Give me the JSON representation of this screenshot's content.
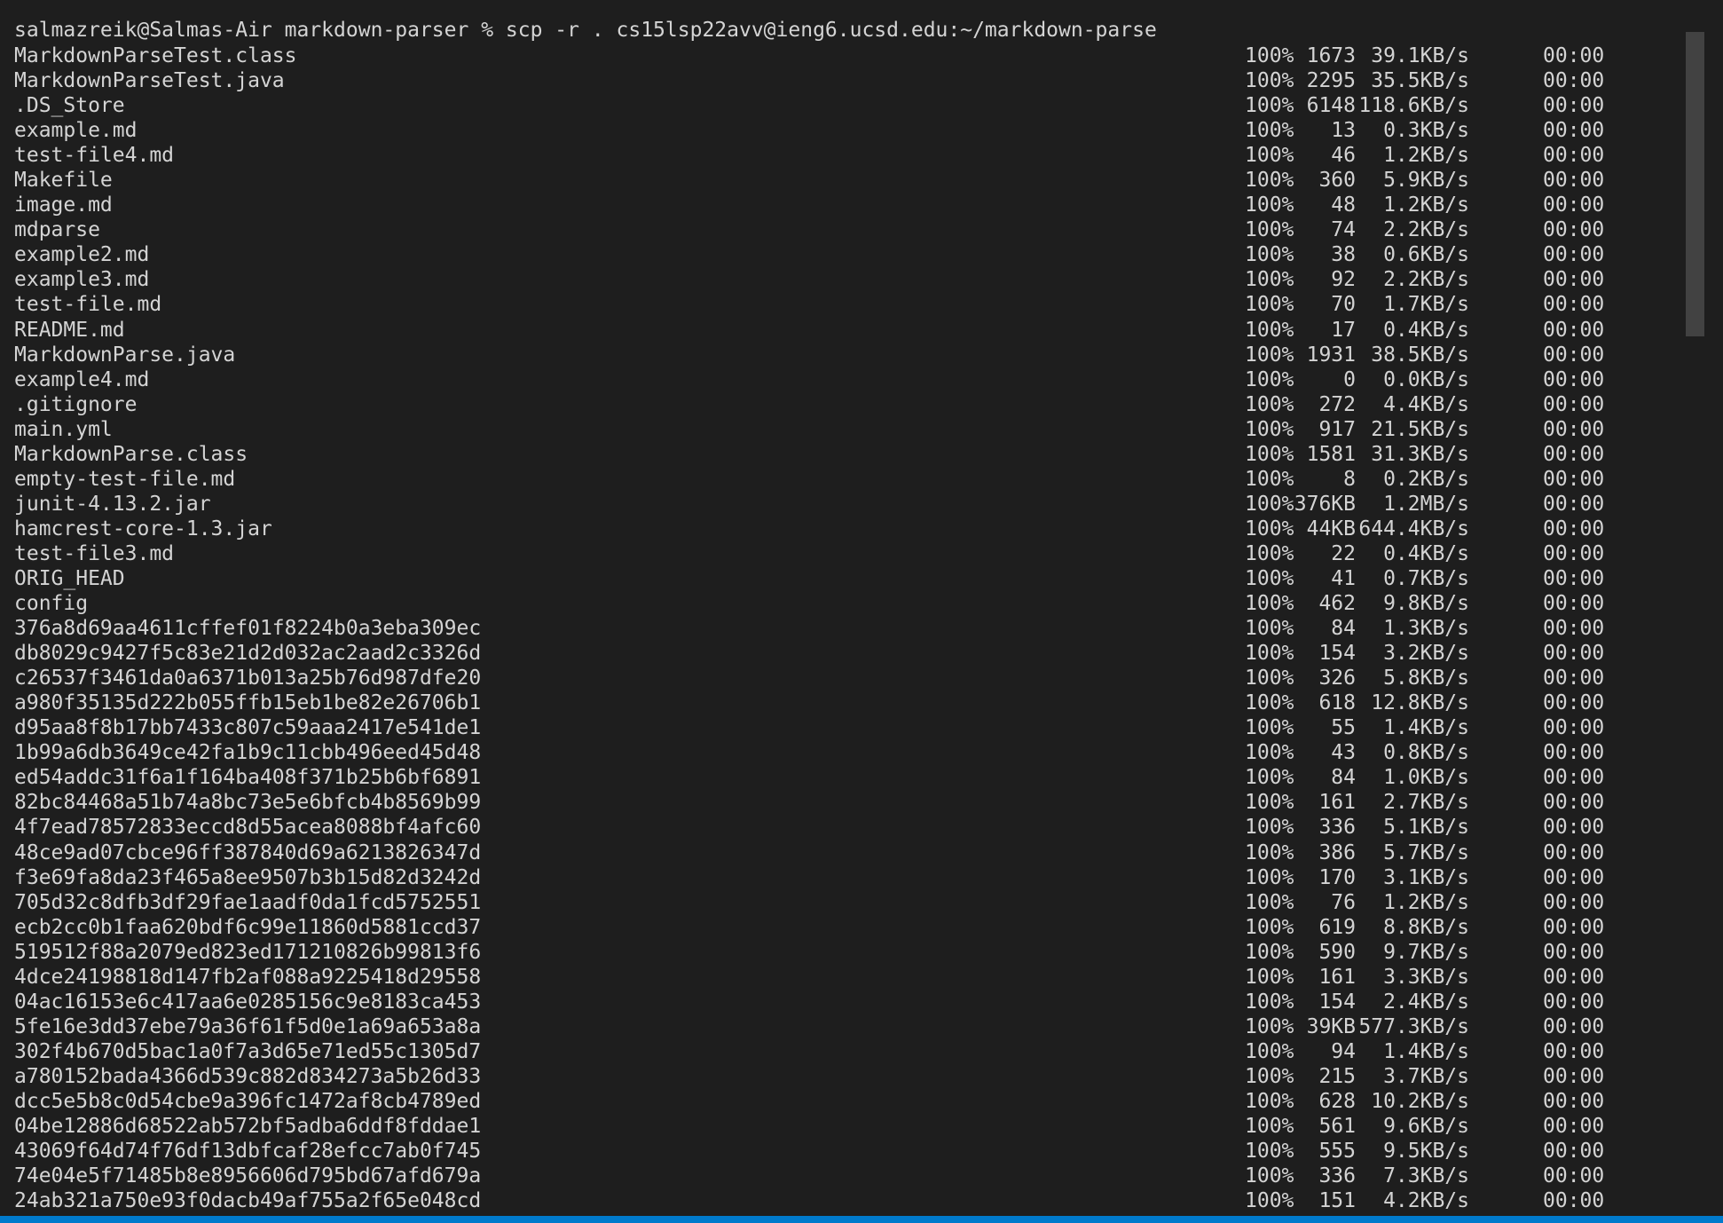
{
  "terminal": {
    "prompt": "salmazreik@Salmas-Air markdown-parser % ",
    "command": "scp -r . cs15lsp22avv@ieng6.ucsd.edu:~/markdown-parse",
    "rows": [
      {
        "file": "MarkdownParseTest.class",
        "pct": "100%",
        "size": "1673",
        "speed": "39.1KB/s",
        "eta": "00:00"
      },
      {
        "file": "MarkdownParseTest.java",
        "pct": "100%",
        "size": "2295",
        "speed": "35.5KB/s",
        "eta": "00:00"
      },
      {
        "file": ".DS_Store",
        "pct": "100%",
        "size": "6148",
        "speed": "118.6KB/s",
        "eta": "00:00"
      },
      {
        "file": "example.md",
        "pct": "100%",
        "size": "13",
        "speed": "0.3KB/s",
        "eta": "00:00"
      },
      {
        "file": "test-file4.md",
        "pct": "100%",
        "size": "46",
        "speed": "1.2KB/s",
        "eta": "00:00"
      },
      {
        "file": "Makefile",
        "pct": "100%",
        "size": "360",
        "speed": "5.9KB/s",
        "eta": "00:00"
      },
      {
        "file": "image.md",
        "pct": "100%",
        "size": "48",
        "speed": "1.2KB/s",
        "eta": "00:00"
      },
      {
        "file": "mdparse",
        "pct": "100%",
        "size": "74",
        "speed": "2.2KB/s",
        "eta": "00:00"
      },
      {
        "file": "example2.md",
        "pct": "100%",
        "size": "38",
        "speed": "0.6KB/s",
        "eta": "00:00"
      },
      {
        "file": "example3.md",
        "pct": "100%",
        "size": "92",
        "speed": "2.2KB/s",
        "eta": "00:00"
      },
      {
        "file": "test-file.md",
        "pct": "100%",
        "size": "70",
        "speed": "1.7KB/s",
        "eta": "00:00"
      },
      {
        "file": "README.md",
        "pct": "100%",
        "size": "17",
        "speed": "0.4KB/s",
        "eta": "00:00"
      },
      {
        "file": "MarkdownParse.java",
        "pct": "100%",
        "size": "1931",
        "speed": "38.5KB/s",
        "eta": "00:00"
      },
      {
        "file": "example4.md",
        "pct": "100%",
        "size": "0",
        "speed": "0.0KB/s",
        "eta": "00:00"
      },
      {
        "file": ".gitignore",
        "pct": "100%",
        "size": "272",
        "speed": "4.4KB/s",
        "eta": "00:00"
      },
      {
        "file": "main.yml",
        "pct": "100%",
        "size": "917",
        "speed": "21.5KB/s",
        "eta": "00:00"
      },
      {
        "file": "MarkdownParse.class",
        "pct": "100%",
        "size": "1581",
        "speed": "31.3KB/s",
        "eta": "00:00"
      },
      {
        "file": "empty-test-file.md",
        "pct": "100%",
        "size": "8",
        "speed": "0.2KB/s",
        "eta": "00:00"
      },
      {
        "file": "junit-4.13.2.jar",
        "pct": "100%",
        "size": "376KB",
        "speed": "1.2MB/s",
        "eta": "00:00"
      },
      {
        "file": "hamcrest-core-1.3.jar",
        "pct": "100%",
        "size": "44KB",
        "speed": "644.4KB/s",
        "eta": "00:00"
      },
      {
        "file": "test-file3.md",
        "pct": "100%",
        "size": "22",
        "speed": "0.4KB/s",
        "eta": "00:00"
      },
      {
        "file": "ORIG_HEAD",
        "pct": "100%",
        "size": "41",
        "speed": "0.7KB/s",
        "eta": "00:00"
      },
      {
        "file": "config",
        "pct": "100%",
        "size": "462",
        "speed": "9.8KB/s",
        "eta": "00:00"
      },
      {
        "file": "376a8d69aa4611cffef01f8224b0a3eba309ec",
        "pct": "100%",
        "size": "84",
        "speed": "1.3KB/s",
        "eta": "00:00"
      },
      {
        "file": "db8029c9427f5c83e21d2d032ac2aad2c3326d",
        "pct": "100%",
        "size": "154",
        "speed": "3.2KB/s",
        "eta": "00:00"
      },
      {
        "file": "c26537f3461da0a6371b013a25b76d987dfe20",
        "pct": "100%",
        "size": "326",
        "speed": "5.8KB/s",
        "eta": "00:00"
      },
      {
        "file": "a980f35135d222b055ffb15eb1be82e26706b1",
        "pct": "100%",
        "size": "618",
        "speed": "12.8KB/s",
        "eta": "00:00"
      },
      {
        "file": "d95aa8f8b17bb7433c807c59aaa2417e541de1",
        "pct": "100%",
        "size": "55",
        "speed": "1.4KB/s",
        "eta": "00:00"
      },
      {
        "file": "1b99a6db3649ce42fa1b9c11cbb496eed45d48",
        "pct": "100%",
        "size": "43",
        "speed": "0.8KB/s",
        "eta": "00:00"
      },
      {
        "file": "ed54addc31f6a1f164ba408f371b25b6bf6891",
        "pct": "100%",
        "size": "84",
        "speed": "1.0KB/s",
        "eta": "00:00"
      },
      {
        "file": "82bc84468a51b74a8bc73e5e6bfcb4b8569b99",
        "pct": "100%",
        "size": "161",
        "speed": "2.7KB/s",
        "eta": "00:00"
      },
      {
        "file": "4f7ead78572833eccd8d55acea8088bf4afc60",
        "pct": "100%",
        "size": "336",
        "speed": "5.1KB/s",
        "eta": "00:00"
      },
      {
        "file": "48ce9ad07cbce96ff387840d69a6213826347d",
        "pct": "100%",
        "size": "386",
        "speed": "5.7KB/s",
        "eta": "00:00"
      },
      {
        "file": "f3e69fa8da23f465a8ee9507b3b15d82d3242d",
        "pct": "100%",
        "size": "170",
        "speed": "3.1KB/s",
        "eta": "00:00"
      },
      {
        "file": "705d32c8dfb3df29fae1aadf0da1fcd5752551",
        "pct": "100%",
        "size": "76",
        "speed": "1.2KB/s",
        "eta": "00:00"
      },
      {
        "file": "ecb2cc0b1faa620bdf6c99e11860d5881ccd37",
        "pct": "100%",
        "size": "619",
        "speed": "8.8KB/s",
        "eta": "00:00"
      },
      {
        "file": "519512f88a2079ed823ed171210826b99813f6",
        "pct": "100%",
        "size": "590",
        "speed": "9.7KB/s",
        "eta": "00:00"
      },
      {
        "file": "4dce24198818d147fb2af088a9225418d29558",
        "pct": "100%",
        "size": "161",
        "speed": "3.3KB/s",
        "eta": "00:00"
      },
      {
        "file": "04ac16153e6c417aa6e0285156c9e8183ca453",
        "pct": "100%",
        "size": "154",
        "speed": "2.4KB/s",
        "eta": "00:00"
      },
      {
        "file": "5fe16e3dd37ebe79a36f61f5d0e1a69a653a8a",
        "pct": "100%",
        "size": "39KB",
        "speed": "577.3KB/s",
        "eta": "00:00"
      },
      {
        "file": "302f4b670d5bac1a0f7a3d65e71ed55c1305d7",
        "pct": "100%",
        "size": "94",
        "speed": "1.4KB/s",
        "eta": "00:00"
      },
      {
        "file": "a780152bada4366d539c882d834273a5b26d33",
        "pct": "100%",
        "size": "215",
        "speed": "3.7KB/s",
        "eta": "00:00"
      },
      {
        "file": "dcc5e5b8c0d54cbe9a396fc1472af8cb4789ed",
        "pct": "100%",
        "size": "628",
        "speed": "10.2KB/s",
        "eta": "00:00"
      },
      {
        "file": "04be12886d68522ab572bf5adba6ddf8fddae1",
        "pct": "100%",
        "size": "561",
        "speed": "9.6KB/s",
        "eta": "00:00"
      },
      {
        "file": "43069f64d74f76df13dbfcaf28efcc7ab0f745",
        "pct": "100%",
        "size": "555",
        "speed": "9.5KB/s",
        "eta": "00:00"
      },
      {
        "file": "74e04e5f71485b8e8956606d795bd67afd679a",
        "pct": "100%",
        "size": "336",
        "speed": "7.3KB/s",
        "eta": "00:00"
      },
      {
        "file": "24ab321a750e93f0dacb49af755a2f65e048cd",
        "pct": "100%",
        "size": "151",
        "speed": "4.2KB/s",
        "eta": "00:00"
      }
    ]
  },
  "colors": {
    "background": "#1e1e1e",
    "text": "#d4d4d4",
    "scrollbar_thumb": "#424242",
    "status_bar": "#007acc"
  }
}
